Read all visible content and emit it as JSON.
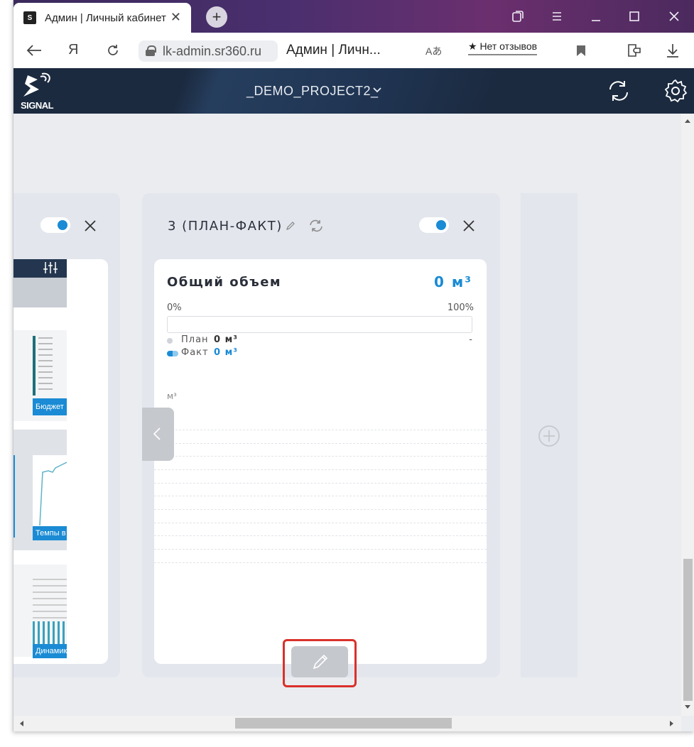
{
  "browser": {
    "tab_title": "Админ | Личный кабинет",
    "tab_close": "✕",
    "new_tab": "+",
    "url": "lk-admin.sr360.ru",
    "page_title": "Админ | Личн...",
    "reviews": "★ Нет отзывов",
    "translate_icon_text": "Aあ",
    "yandex_label": "Я"
  },
  "header": {
    "logo_text": "SIGNAL",
    "project_name": "_DEMO_PROJECT2_"
  },
  "left_panel": {
    "labels": [
      "Бюджет",
      "Темпы в",
      "Динамик"
    ],
    "partial_glyph": "?"
  },
  "main_panel": {
    "title": "3 (ПЛАН-ФАКТ)",
    "metric": {
      "title": "Общий объем",
      "value": "0 м³",
      "progress_min": "0%",
      "progress_max": "100%",
      "progress_fraction": 0,
      "plan_label": "План",
      "plan_value": "0 м³",
      "plan_dash": "-",
      "fact_label": "Факт",
      "fact_value": "0 м³",
      "unit_label": "м³"
    }
  },
  "colors": {
    "accent": "#1a8bd4",
    "header_bg": "#1b2a3f",
    "highlight": "#d9312b"
  }
}
